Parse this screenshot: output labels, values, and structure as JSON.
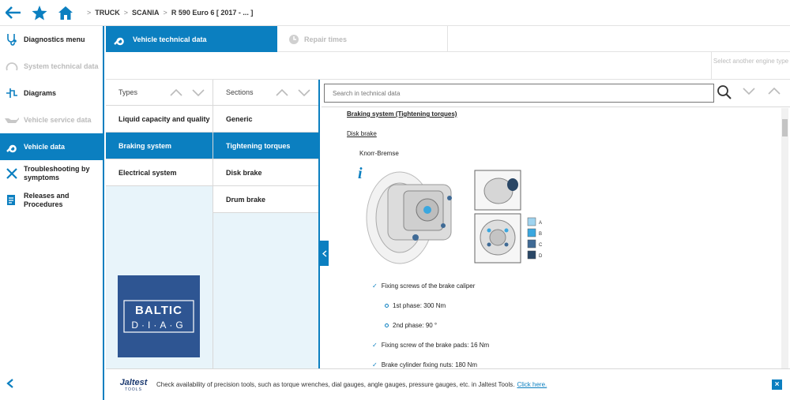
{
  "colors": {
    "accent": "#0b7fc0",
    "logo_bg": "#2e5592",
    "light_panel": "#e8f4fa"
  },
  "breadcrumb": [
    "TRUCK",
    "SCANIA",
    "R 590 Euro 6 [ 2017 - ... ]"
  ],
  "sidebar": {
    "items": [
      {
        "label": "Diagnostics menu",
        "icon": "stethoscope-icon",
        "state": "normal"
      },
      {
        "label": "System technical data",
        "icon": "gauge-icon",
        "state": "disabled"
      },
      {
        "label": "Diagrams",
        "icon": "diagram-icon",
        "state": "normal"
      },
      {
        "label": "Vehicle service data",
        "icon": "oil-can-icon",
        "state": "disabled"
      },
      {
        "label": "Vehicle data",
        "icon": "wrench-icon",
        "state": "active"
      },
      {
        "label": "Troubleshooting by symptoms",
        "icon": "tools-icon",
        "state": "normal"
      },
      {
        "label": "Releases and Procedures",
        "icon": "document-icon",
        "state": "normal"
      }
    ]
  },
  "tabs": [
    {
      "label": "Vehicle technical data",
      "active": true
    },
    {
      "label": "Repair times",
      "active": false
    }
  ],
  "engine_selector": "Select another engine type",
  "types": {
    "header": "Types",
    "items": [
      "Liquid capacity and quality",
      "Braking system",
      "Electrical system"
    ],
    "selected": 1
  },
  "sections": {
    "header": "Sections",
    "items": [
      "Generic",
      "Tightening torques",
      "Disk brake",
      "Drum brake"
    ],
    "selected": 1
  },
  "logo": {
    "line1": "BALTIC",
    "line2": "D·I·A·G"
  },
  "content": {
    "search_placeholder": "Search in technical data",
    "title": "Braking system (Tightening torques)",
    "subtitle": "Disk brake",
    "brand": "Knorr-Bremse",
    "legend": [
      "A",
      "B",
      "C",
      "D"
    ],
    "legend_colors": [
      "#9fd3ef",
      "#3aa7df",
      "#3f6a95",
      "#2a4766"
    ],
    "bullets": [
      {
        "text": "Fixing screws of the brake caliper",
        "level": 1
      },
      {
        "text": "1st phase: 300 Nm",
        "level": 2
      },
      {
        "text": "2nd phase: 90 °",
        "level": 2
      },
      {
        "text": "Fixing screw of the brake pads: 16 Nm",
        "level": 1
      },
      {
        "text": "Brake cylinder fixing nuts: 180 Nm",
        "level": 1
      }
    ]
  },
  "footer": {
    "brand": "Jaltest",
    "brand_sub": "TOOLS",
    "message": "Check availability of precision tools, such as torque wrenches, dial gauges, angle gauges, pressure gauges, etc. in Jaltest Tools.",
    "link": "Click here."
  }
}
